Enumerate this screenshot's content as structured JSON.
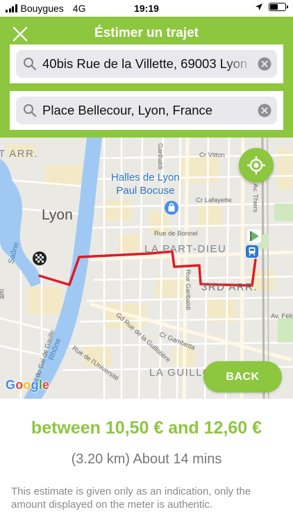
{
  "status_bar": {
    "carrier": "Bouygues",
    "network": "4G",
    "time": "19:19",
    "battery_level": 0.5
  },
  "header": {
    "title": "Éstimer un trajet",
    "close_icon": "close-icon"
  },
  "search": {
    "origin_value": "40bis Rue de la Villette, 69003 Lyon",
    "destination_value": "Place Bellecour, Lyon, France",
    "search_icon": "search-icon",
    "clear_icon": "clear-icon"
  },
  "map": {
    "labels": {
      "district_3rd_arr_left": "T ARR.",
      "city": "Lyon",
      "poi_halles": "Halles de Lyon\nPaul Bocuse",
      "district_part_dieu": "LA PART-DIEU",
      "district_3rd_arr": "3RD ARR.",
      "district_guillotiere": "LA GUILLO",
      "street_garibaldi_top": "Garibaldi",
      "street_cr_vitton": "Cr Vitton",
      "street_cr_lafayette": "Cr Lafayette",
      "street_rue_de_bonnel": "Rue de Bonnel",
      "street_av_thiers": "Av. Thiers",
      "street_rue_garibaldi": "Rue Garibaldi",
      "street_gd_rue_guillotiere": "Gd Rue de la Guillotière",
      "street_cr_gambetta": "Cr Gambetta",
      "street_rue_universite": "Rue de l'Université",
      "street_quai_guillotiere": "Quai du Gal de Gaulle",
      "street_av_felix": "Av. Félix F",
      "street_isitt": "isitt",
      "river_saone": "Saône",
      "river_rhone": "Rhône"
    },
    "google_logo": "Google",
    "route_color": "#e11a22",
    "brand_color": "#8dc63f",
    "locate_icon": "crosshair-icon",
    "origin_marker_icon": "checkered-flag-icon",
    "destination_marker_icon": "play-flag-icon",
    "shopping_icon": "shopping-bag-icon",
    "train_icon": "train-station-icon",
    "back_label": "BACK"
  },
  "estimate": {
    "price_text": "between 10,50 € and 12,60 €",
    "duration_text": "(3.20 km) About 14 mins",
    "disclaimer": "This estimate is given only as an indication, only the amount displayed on the meter is authentic."
  }
}
